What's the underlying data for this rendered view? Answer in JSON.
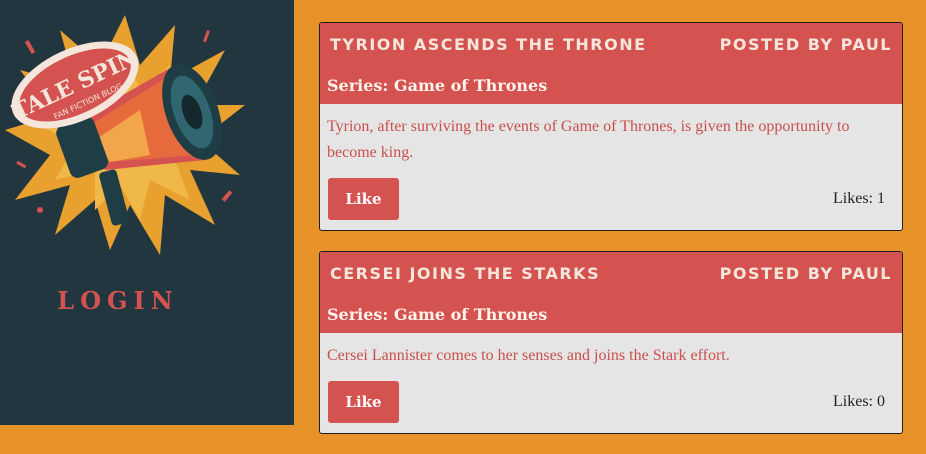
{
  "sidebar": {
    "logo": {
      "title": "TALE SPIN",
      "subtitle": "FAN FICTION BLOG"
    },
    "login_label": "LOGIN"
  },
  "posts": [
    {
      "title": "Tyrion Ascends The Throne",
      "author": "Posted by Paul",
      "series": "Series: Game of Thrones",
      "body": "Tyrion, after surviving the events of Game of Thrones, is given the opportunity to become king.",
      "like_label": "Like",
      "likes": "Likes: 1"
    },
    {
      "title": "Cersei Joins The Starks",
      "author": "Posted by Paul",
      "series": "Series: Game of Thrones",
      "body": "Cersei Lannister comes to her senses and joins the Stark effort.",
      "like_label": "Like",
      "likes": "Likes: 0"
    }
  ],
  "colors": {
    "page_bg": "#e8922a",
    "sidebar_bg": "#223640",
    "accent": "#d4524f",
    "card_bg": "#e5e5e5"
  }
}
